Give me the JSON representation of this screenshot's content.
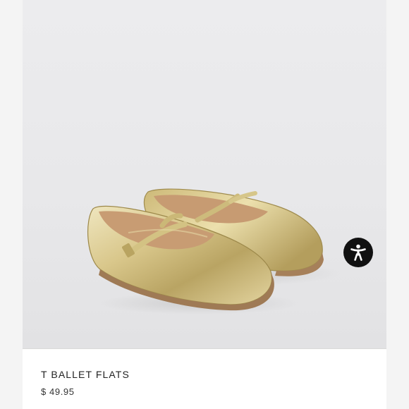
{
  "product": {
    "name": "T BALLET FLATS",
    "price": "$ 49.95",
    "image_alt": "gold-metallic-t-strap-ballet-flats"
  },
  "widgets": {
    "accessibility_icon": "accessibility-person-icon"
  },
  "colors": {
    "page_background": "#f4f4f4",
    "photo_background": "#e8e8ea",
    "shoe_gold": "#d8c58a",
    "accessibility_button": "#111111"
  }
}
